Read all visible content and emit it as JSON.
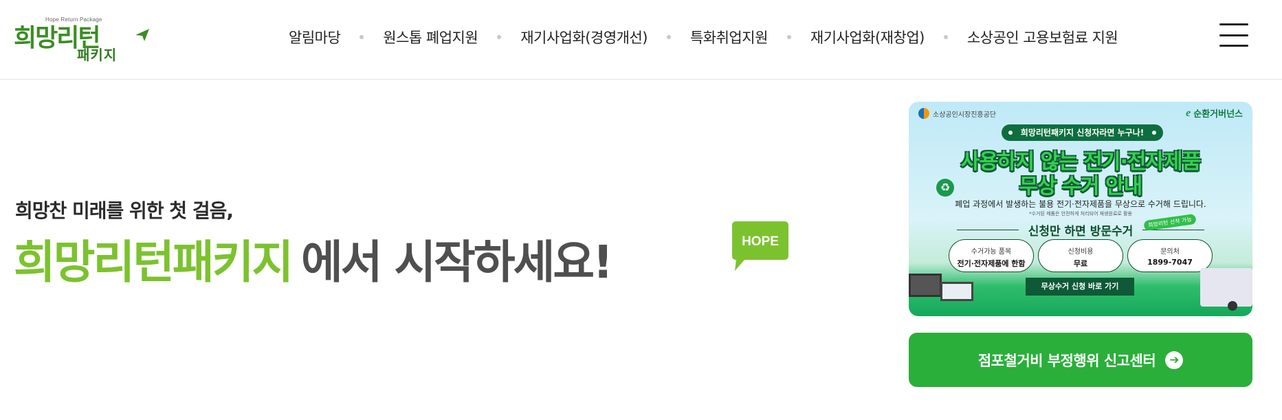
{
  "logo": {
    "english": "Hope Return Package",
    "main": "희망리턴",
    "sub": "패키지"
  },
  "nav": {
    "items": [
      "알림마당",
      "원스톱 폐업지원",
      "재기사업화(경영개선)",
      "특화취업지원",
      "재기사업화(재창업)",
      "소상공인 고용보험료 지원"
    ]
  },
  "hero": {
    "subtitle": "희망찬 미래를 위한 첫 걸음,",
    "title_green": "희망리턴패키지",
    "title_gray": "에서 시작하세요!",
    "badge": "HOPE"
  },
  "banner": {
    "org_left": "소상공인시장진흥공단",
    "org_right": "순환거버넌스",
    "pill": "희망리턴패키지 신청자라면 누구나!",
    "headline1": "사용하지 않는 전기·전자제품",
    "headline2": "무상 수거 안내",
    "description": "폐업 과정에서 발생하는 불용 전기·전자제품을 무상으로 수거해 드립니다.",
    "note": "*수거된 제품은 안전하게 처리되어 재생원료로 활용",
    "apply_line": "신청만 하면 방문수거",
    "tag": "희망리턴 선착 가능",
    "boxes": [
      {
        "title": "수거가능 품목",
        "value": "전기·전자제품에 한함"
      },
      {
        "title": "신청비용",
        "value": "무료"
      },
      {
        "title": "문의처",
        "value": "1899-7047"
      }
    ],
    "cta": "무상수거 신청 바로 가기"
  },
  "report_button": {
    "label": "점포철거비 부정행위 신고센터"
  },
  "colors": {
    "brand_green": "#7cc22e",
    "dark_green": "#3b8d24",
    "button_green": "#2aaf3a",
    "title_gray": "#4f4f4f"
  }
}
